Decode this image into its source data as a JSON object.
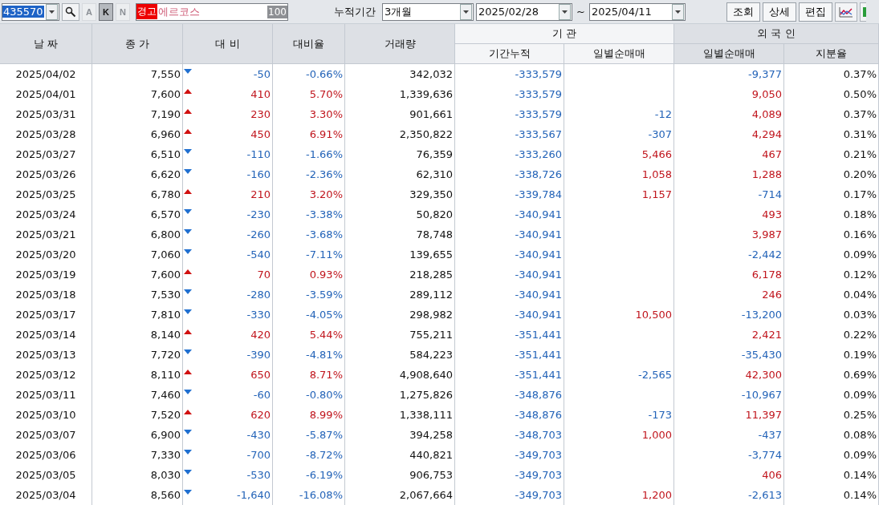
{
  "toolbar": {
    "code": {
      "value": "435570",
      "selected": true
    },
    "market_buttons": [
      {
        "label": "A",
        "selected": false
      },
      {
        "label": "K",
        "selected": true
      },
      {
        "label": "N",
        "selected": false
      }
    ],
    "stock": {
      "badge": "경고",
      "name": "에르코스",
      "score": "100"
    },
    "period_label": "누적기간",
    "period": "3개월",
    "date_from": "2025/02/28",
    "separator": "~",
    "date_to": "2025/04/11",
    "buttons": [
      "조회",
      "상세",
      "편집"
    ]
  },
  "table": {
    "columns": [
      "날 짜",
      "종 가",
      "대 비",
      "대비율",
      "거래량"
    ],
    "groups": [
      {
        "label": "기    관",
        "shaded": false,
        "columns": [
          "기간누적",
          "일별순매매"
        ]
      },
      {
        "label": "외 국 인",
        "shaded": true,
        "columns": [
          "일별순매매",
          "지분율"
        ]
      }
    ],
    "rows": [
      {
        "date": "2025/04/02",
        "close": "7,550",
        "up": false,
        "change": "-50",
        "rate": "-0.66%",
        "volume": "342,032",
        "inst_cum": "-333,579",
        "foreign_daily": "-9,377",
        "foreign_share": "0.37%"
      },
      {
        "date": "2025/04/01",
        "close": "7,600",
        "up": true,
        "change": "410",
        "rate": "5.70%",
        "volume": "1,339,636",
        "inst_cum": "-333,579",
        "foreign_daily": "9,050",
        "foreign_share": "0.50%"
      },
      {
        "date": "2025/03/31",
        "close": "7,190",
        "up": true,
        "change": "230",
        "rate": "3.30%",
        "volume": "901,661",
        "inst_cum": "-333,579",
        "inst_daily": "-12",
        "foreign_daily": "4,089",
        "foreign_share": "0.37%"
      },
      {
        "date": "2025/03/28",
        "close": "6,960",
        "up": true,
        "change": "450",
        "rate": "6.91%",
        "volume": "2,350,822",
        "inst_cum": "-333,567",
        "inst_daily": "-307",
        "foreign_daily": "4,294",
        "foreign_share": "0.31%"
      },
      {
        "date": "2025/03/27",
        "close": "6,510",
        "up": false,
        "change": "-110",
        "rate": "-1.66%",
        "volume": "76,359",
        "inst_cum": "-333,260",
        "inst_daily": "5,466",
        "foreign_daily": "467",
        "foreign_share": "0.21%"
      },
      {
        "date": "2025/03/26",
        "close": "6,620",
        "up": false,
        "change": "-160",
        "rate": "-2.36%",
        "volume": "62,310",
        "inst_cum": "-338,726",
        "inst_daily": "1,058",
        "foreign_daily": "1,288",
        "foreign_share": "0.20%"
      },
      {
        "date": "2025/03/25",
        "close": "6,780",
        "up": true,
        "change": "210",
        "rate": "3.20%",
        "volume": "329,350",
        "inst_cum": "-339,784",
        "inst_daily": "1,157",
        "foreign_daily": "-714",
        "foreign_share": "0.17%"
      },
      {
        "date": "2025/03/24",
        "close": "6,570",
        "up": false,
        "change": "-230",
        "rate": "-3.38%",
        "volume": "50,820",
        "inst_cum": "-340,941",
        "foreign_daily": "493",
        "foreign_share": "0.18%"
      },
      {
        "date": "2025/03/21",
        "close": "6,800",
        "up": false,
        "change": "-260",
        "rate": "-3.68%",
        "volume": "78,748",
        "inst_cum": "-340,941",
        "foreign_daily": "3,987",
        "foreign_share": "0.16%"
      },
      {
        "date": "2025/03/20",
        "close": "7,060",
        "up": false,
        "change": "-540",
        "rate": "-7.11%",
        "volume": "139,655",
        "inst_cum": "-340,941",
        "foreign_daily": "-2,442",
        "foreign_share": "0.09%"
      },
      {
        "date": "2025/03/19",
        "close": "7,600",
        "up": true,
        "change": "70",
        "rate": "0.93%",
        "volume": "218,285",
        "inst_cum": "-340,941",
        "foreign_daily": "6,178",
        "foreign_share": "0.12%"
      },
      {
        "date": "2025/03/18",
        "close": "7,530",
        "up": false,
        "change": "-280",
        "rate": "-3.59%",
        "volume": "289,112",
        "inst_cum": "-340,941",
        "foreign_daily": "246",
        "foreign_share": "0.04%"
      },
      {
        "date": "2025/03/17",
        "close": "7,810",
        "up": false,
        "change": "-330",
        "rate": "-4.05%",
        "volume": "298,982",
        "inst_cum": "-340,941",
        "inst_daily": "10,500",
        "foreign_daily": "-13,200",
        "foreign_share": "0.03%"
      },
      {
        "date": "2025/03/14",
        "close": "8,140",
        "up": true,
        "change": "420",
        "rate": "5.44%",
        "volume": "755,211",
        "inst_cum": "-351,441",
        "foreign_daily": "2,421",
        "foreign_share": "0.22%"
      },
      {
        "date": "2025/03/13",
        "close": "7,720",
        "up": false,
        "change": "-390",
        "rate": "-4.81%",
        "volume": "584,223",
        "inst_cum": "-351,441",
        "foreign_daily": "-35,430",
        "foreign_share": "0.19%"
      },
      {
        "date": "2025/03/12",
        "close": "8,110",
        "up": true,
        "change": "650",
        "rate": "8.71%",
        "volume": "4,908,640",
        "inst_cum": "-351,441",
        "inst_daily": "-2,565",
        "foreign_daily": "42,300",
        "foreign_share": "0.69%"
      },
      {
        "date": "2025/03/11",
        "close": "7,460",
        "up": false,
        "change": "-60",
        "rate": "-0.80%",
        "volume": "1,275,826",
        "inst_cum": "-348,876",
        "foreign_daily": "-10,967",
        "foreign_share": "0.09%"
      },
      {
        "date": "2025/03/10",
        "close": "7,520",
        "up": true,
        "change": "620",
        "rate": "8.99%",
        "volume": "1,338,111",
        "inst_cum": "-348,876",
        "inst_daily": "-173",
        "foreign_daily": "11,397",
        "foreign_share": "0.25%"
      },
      {
        "date": "2025/03/07",
        "close": "6,900",
        "up": false,
        "change": "-430",
        "rate": "-5.87%",
        "volume": "394,258",
        "inst_cum": "-348,703",
        "inst_daily": "1,000",
        "foreign_daily": "-437",
        "foreign_share": "0.08%"
      },
      {
        "date": "2025/03/06",
        "close": "7,330",
        "up": false,
        "change": "-700",
        "rate": "-8.72%",
        "volume": "440,821",
        "inst_cum": "-349,703",
        "foreign_daily": "-3,774",
        "foreign_share": "0.09%"
      },
      {
        "date": "2025/03/05",
        "close": "8,030",
        "up": false,
        "change": "-530",
        "rate": "-6.19%",
        "volume": "906,753",
        "inst_cum": "-349,703",
        "foreign_daily": "406",
        "foreign_share": "0.14%"
      },
      {
        "date": "2025/03/04",
        "close": "8,560",
        "up": false,
        "change": "-1,640",
        "rate": "-16.08%",
        "volume": "2,067,664",
        "inst_cum": "-349,703",
        "inst_daily": "1,200",
        "foreign_daily": "-2,613",
        "foreign_share": "0.14%"
      }
    ]
  }
}
